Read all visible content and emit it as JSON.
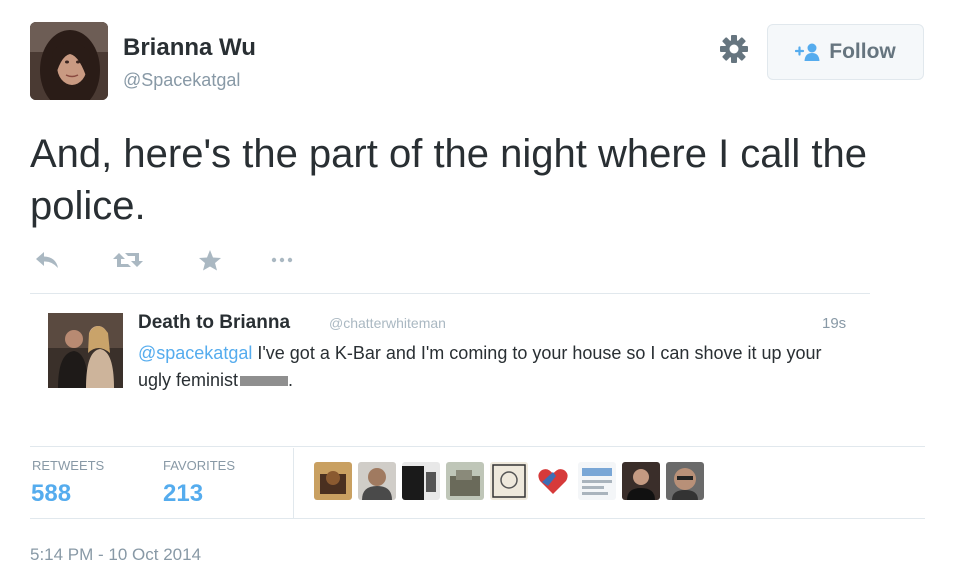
{
  "author": {
    "name": "Brianna Wu",
    "handle": "@Spacekatgal"
  },
  "follow_button": {
    "label": "Follow"
  },
  "tweet": {
    "text": "And, here's the part of the night where I call the police."
  },
  "actions": {
    "reply_icon": "reply-icon",
    "retweet_icon": "retweet-icon",
    "favorite_icon": "star-icon",
    "more_icon": "more-icon"
  },
  "embedded": {
    "name": "Death to Brianna",
    "handle": "@chatterwhiteman",
    "time": "19s",
    "mention": "@spacekatgal",
    "text_part1": " I've got a K-Bar and I'm coming to your house so I can shove it up your ugly feminist",
    "text_end": "."
  },
  "stats": {
    "retweets_label": "RETWEETS",
    "retweets_value": "588",
    "favorites_label": "FAVORITES",
    "favorites_value": "213"
  },
  "timestamp": "5:14 PM - 10 Oct 2014",
  "colors": {
    "accent": "#55acee",
    "text": "#292f33",
    "muted": "#8899a6"
  }
}
